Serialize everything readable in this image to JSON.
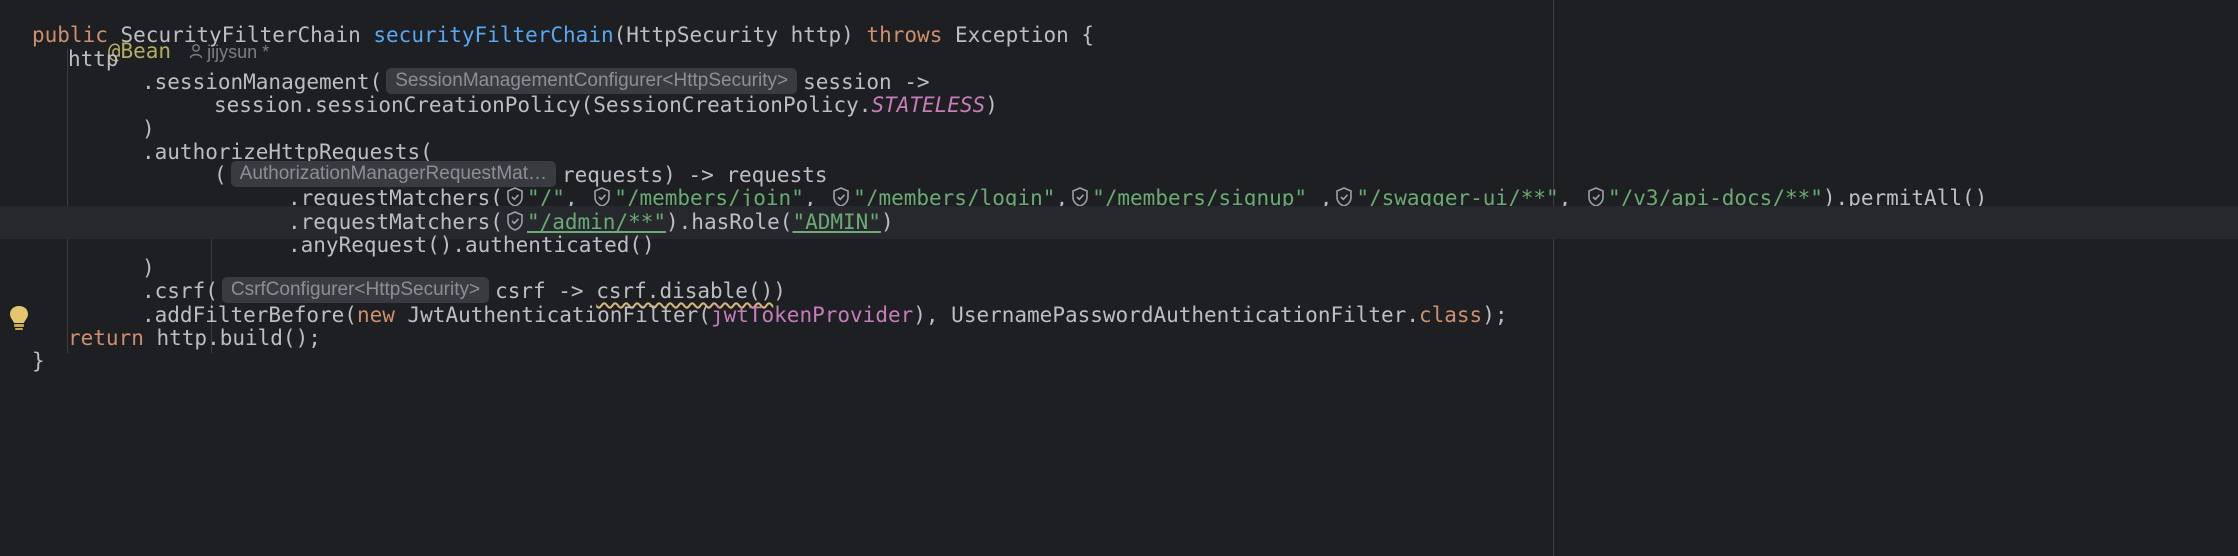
{
  "editor": {
    "annotation": "@Bean",
    "author": "jijysun *",
    "kw_public": "public",
    "return_type": "SecurityFilterChain",
    "method_name": "securityFilterChain",
    "params": "(HttpSecurity http)",
    "kw_throws": "throws",
    "exception_clause": "Exception {",
    "http": "http",
    "session_mgmt": ".sessionManagement(",
    "hint_session_type": "SessionManagementConfigurer<HttpSecurity>",
    "session_lambda": "session ->",
    "session_policy_call": "session.sessionCreationPolicy(SessionCreationPolicy.",
    "stateless": "STATELESS",
    "close_paren_1": ")",
    "close_paren_paren": ")",
    "authorize_requests": ".authorizeHttpRequests(",
    "open_paren": "(",
    "hint_auth_type": "AuthorizationManagerRequestMat…",
    "requests_lambda": "requests) -> requests",
    "request_matchers": ".requestMatchers(",
    "path_root": "\"/\"",
    "comma": ",",
    "path_members_join": "\"/members/join\"",
    "path_members_login": "\"/members/login\"",
    "path_members_signup": "\"/members/signup\"",
    "path_swagger": "\"/swagger-ui/**\"",
    "path_api_docs": "\"/v3/api-docs/**\"",
    "permit_all": ").permitAll()",
    "path_admin": "\"/admin/**\"",
    "has_role": ").hasRole(",
    "role_admin": "\"ADMIN\"",
    "any_request": ".anyRequest().authenticated()",
    "close_paren_2": ")",
    "csrf_call": ".csrf(",
    "hint_csrf_type": "CsrfConfigurer<HttpSecurity>",
    "csrf_lambda": "csrf -> ",
    "csrf_disable": "csrf.disable()",
    "csrf_close": ")",
    "add_filter": ".addFilterBefore(",
    "kw_new": "new",
    "jwt_filter": " JwtAuthenticationFilter(",
    "jwt_provider": "jwtTokenProvider",
    "username_filter": "), UsernamePasswordAuthenticationFilter.",
    "kw_class": "class",
    "semicolon_end": ");",
    "kw_return": "return",
    "return_expr": " http.build();",
    "closing_brace": "}"
  },
  "colors": {
    "background": "#1e1f22",
    "keyword": "#cf8e6d",
    "annotation": "#b3ae60",
    "method": "#56a8f5",
    "string": "#6aab73",
    "constant": "#c77dbb",
    "text": "#bcbec4"
  },
  "icons": {
    "author": "user-icon",
    "shield": "shield-icon",
    "gutter": "lightbulb-icon"
  }
}
